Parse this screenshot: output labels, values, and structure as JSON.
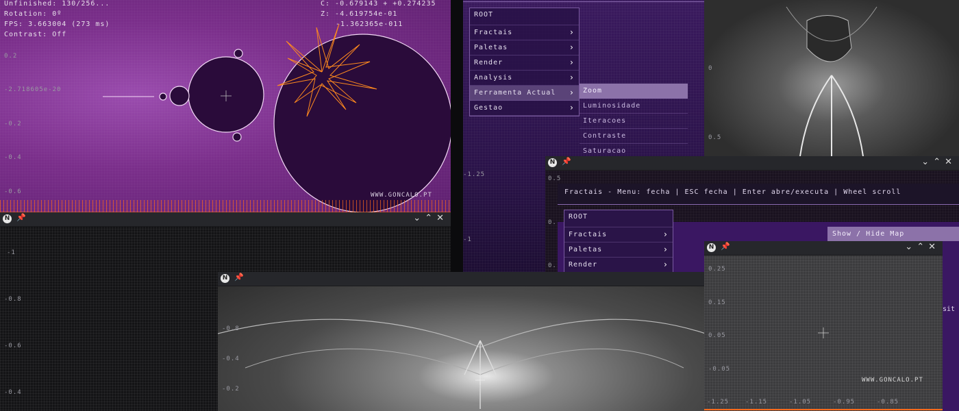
{
  "colors": {
    "purple_bg": "#7a2e8a",
    "set_fill": "#2a0b3a",
    "orbit": "#ff8a1e",
    "menu_active": "#5a4378",
    "sub_active": "#8c72a9"
  },
  "window_controls": {
    "logo": "N",
    "pin": "📌",
    "minimize": "⌄",
    "maximize": "⌃",
    "close": "✕"
  },
  "mandel": {
    "hud": {
      "line1": "Unfinished: 130/256...",
      "line2": "Rotation: 0º",
      "line3": "FPS: 3.663004 (273 ms)",
      "line4": "Contrast: Off"
    },
    "coords": {
      "c": "C: -0.679143 + +0.274235",
      "z": "Z: -4.619754e-01",
      "z2": "-1.362365e-011"
    },
    "y_ticks": [
      "0.2",
      "-2.718605e-20",
      "-0.2",
      "-0.4",
      "-0.6"
    ],
    "watermark": "WWW.GONCALO.PT"
  },
  "dark_left": {
    "y_ticks": [
      "-1",
      "-0.8",
      "-0.6",
      "-0.4"
    ]
  },
  "menu_window": {
    "y_ticks": [
      "-1.25",
      "-1"
    ],
    "root": "ROOT",
    "items": [
      {
        "label": "Fractais"
      },
      {
        "label": "Paletas"
      },
      {
        "label": "Render"
      },
      {
        "label": "Analysis"
      },
      {
        "label": "Ferramenta Actual"
      },
      {
        "label": "Gestao"
      }
    ],
    "submenu": [
      {
        "label": "Zoom"
      },
      {
        "label": "Luminosidade"
      },
      {
        "label": "Iteracoes"
      },
      {
        "label": "Contraste"
      },
      {
        "label": "Saturacao"
      }
    ]
  },
  "top_right": {
    "y_ticks": [
      "0",
      "0.5"
    ]
  },
  "help_window": {
    "header": "Fractais - Menu: fecha | ESC fecha | Enter abre/executa | Wheel scroll",
    "y_ticks": [
      "0.5",
      "0.",
      "0."
    ],
    "root": "ROOT",
    "items": [
      {
        "label": "Fractais"
      },
      {
        "label": "Paletas"
      },
      {
        "label": "Render"
      }
    ],
    "side_button": "Show / Hide Map",
    "side_fragment": "sit"
  },
  "bottom_window": {
    "y_ticks": [
      "-0.8",
      "-0.4",
      "-0.2"
    ]
  },
  "small_window": {
    "y_ticks": [
      "0.25",
      "0.15",
      "0.05",
      "-0.05"
    ],
    "x_ticks": [
      "-1.25",
      "-1.15",
      "-1.05",
      "-0.95",
      "-0.85"
    ],
    "watermark": "WWW.GONCALO.PT"
  }
}
